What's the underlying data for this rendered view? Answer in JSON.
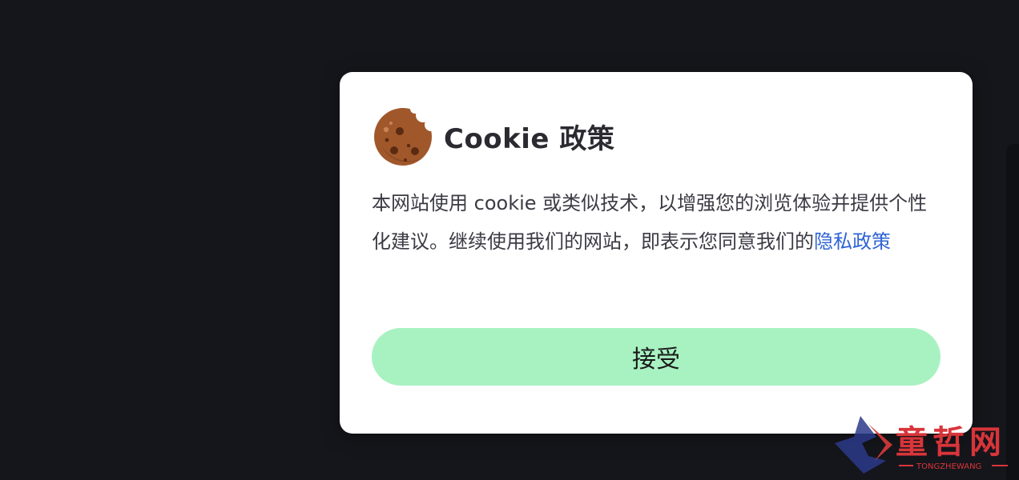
{
  "cookie_dialog": {
    "icon": "cookie-icon",
    "title": "Cookie 政策",
    "message_before_link": "本网站使用 cookie 或类似技术，以增强您的浏览体验并提供个性化建议。继续使用我们的网站，即表示您同意我们的",
    "policy_link_label": "隐私政策",
    "accept_label": "接受",
    "colors": {
      "background": "#15161b",
      "dialog": "#ffffff",
      "accept_button": "#a8f2c2",
      "link": "#2f64d4"
    }
  },
  "watermark": {
    "text": "童哲网",
    "subtext": "TONGZHEWANG"
  }
}
